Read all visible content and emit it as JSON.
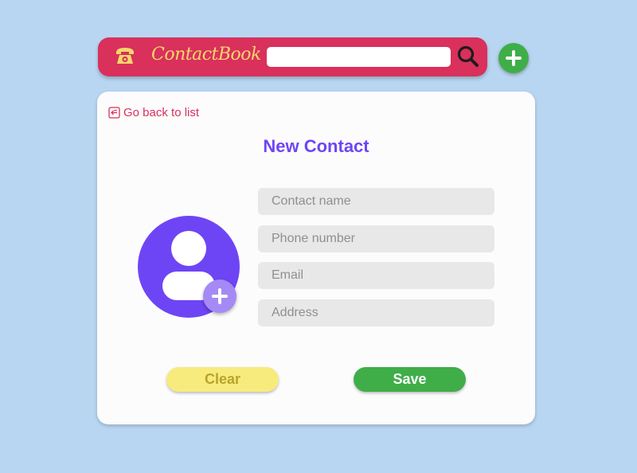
{
  "header": {
    "brand": "ContactBook",
    "search": {
      "value": "",
      "placeholder": ""
    },
    "icons": {
      "phone": "telephone-icon",
      "search": "magnifier-icon",
      "add": "plus-icon"
    }
  },
  "form": {
    "back_label": "Go back to list",
    "title": "New Contact",
    "fields": {
      "name": {
        "placeholder": "Contact name",
        "value": ""
      },
      "phone": {
        "placeholder": "Phone number",
        "value": ""
      },
      "email": {
        "placeholder": "Email",
        "value": ""
      },
      "address": {
        "placeholder": "Address",
        "value": ""
      }
    },
    "clear_label": "Clear",
    "save_label": "Save"
  },
  "colors": {
    "background": "#b8d6f1",
    "header": "#d9305c",
    "brand_text": "#f4d76a",
    "accent": "#6e45f5",
    "avatar_add": "#a58af6",
    "save": "#3fae48",
    "clear": "#f8eb7e",
    "clear_text": "#b8a42a"
  }
}
